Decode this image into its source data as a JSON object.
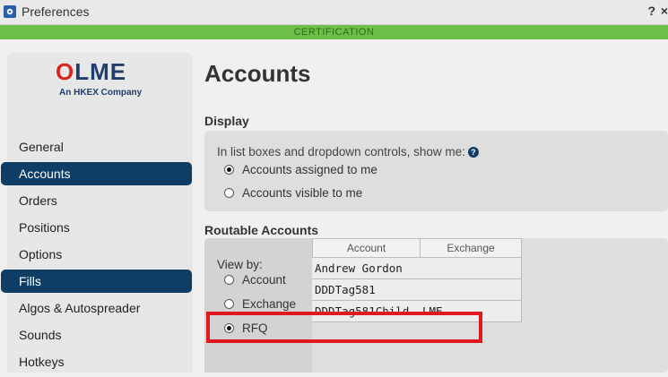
{
  "window": {
    "title": "Preferences",
    "help_label": "?",
    "close_label": "×"
  },
  "environment": {
    "label": "CERTIFICATION"
  },
  "logo": {
    "wordmark_prefix": "O",
    "wordmark": "LME",
    "subtitle": "An HKEX Company"
  },
  "sidebar": {
    "items": [
      {
        "label": "General",
        "active": false
      },
      {
        "label": "Accounts",
        "active": true
      },
      {
        "label": "Orders",
        "active": false
      },
      {
        "label": "Positions",
        "active": false
      },
      {
        "label": "Options",
        "active": false
      },
      {
        "label": "Fills",
        "active": true
      },
      {
        "label": "Algos & Autospreader",
        "active": false
      },
      {
        "label": "Sounds",
        "active": false
      },
      {
        "label": "Hotkeys",
        "active": false
      }
    ]
  },
  "main": {
    "title": "Accounts",
    "display": {
      "heading": "Display",
      "lead": "In list boxes and dropdown controls, show me:",
      "options": [
        {
          "label": "Accounts assigned to me",
          "selected": true
        },
        {
          "label": "Accounts visible to me",
          "selected": false
        }
      ]
    },
    "routable": {
      "heading": "Routable Accounts",
      "view_by_label": "View by:",
      "view_by_options": [
        {
          "label": "Account",
          "selected": false
        },
        {
          "label": "Exchange",
          "selected": false
        },
        {
          "label": "RFQ",
          "selected": true
        }
      ],
      "columns": [
        "Account",
        "Exchange"
      ],
      "rows": [
        {
          "account": "Andrew Gordon",
          "exchange": ""
        },
        {
          "account": "DDDTag581",
          "exchange": ""
        },
        {
          "account": "DDDTag581Child",
          "exchange": "LME"
        }
      ]
    }
  },
  "colors": {
    "nav_active": "#0e3e66",
    "env_bar": "#6cc04a",
    "highlight": "#e1181e"
  },
  "icons": {
    "app": "gear-flower-icon",
    "help": "question-circle-icon"
  }
}
